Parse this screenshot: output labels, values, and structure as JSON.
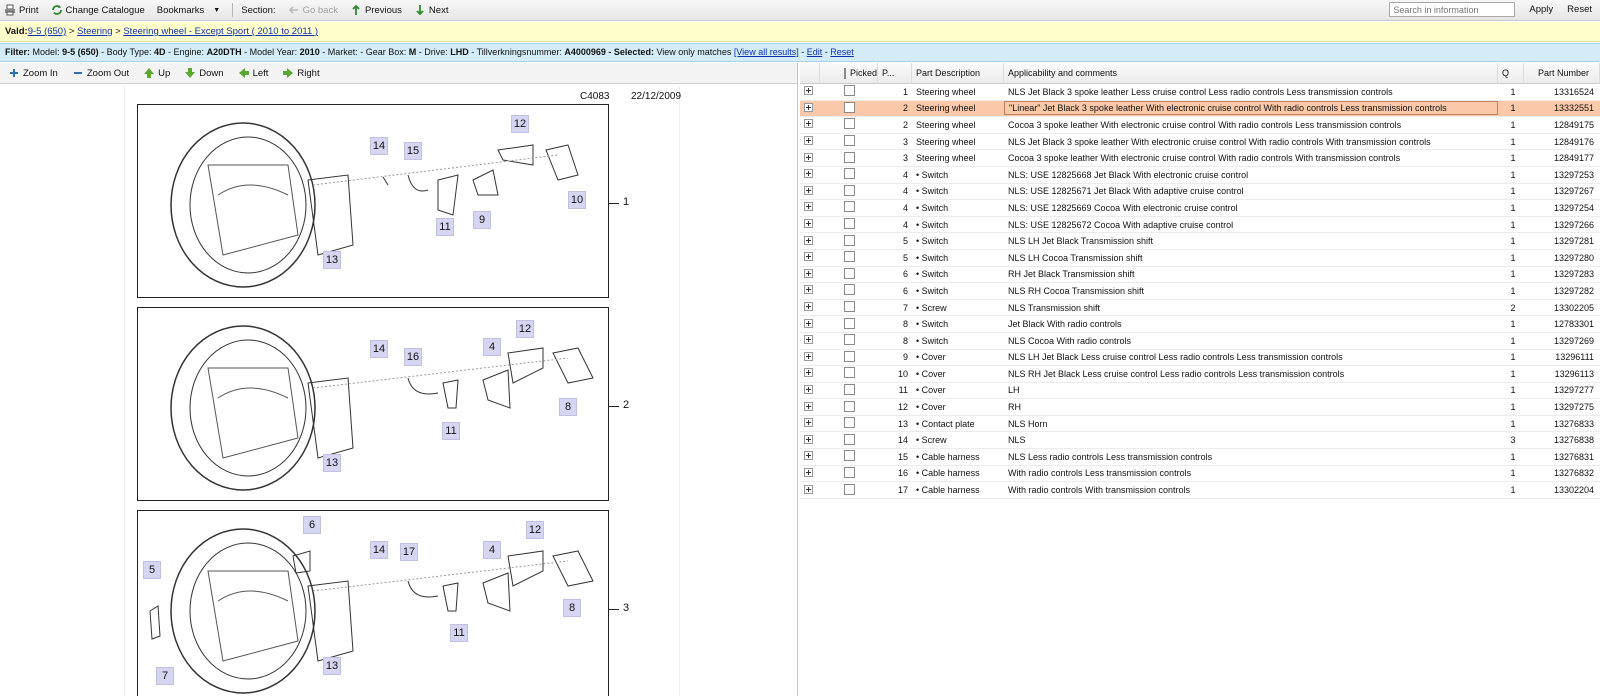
{
  "toolbar": {
    "print": "Print",
    "change_catalogue": "Change Catalogue",
    "bookmarks": "Bookmarks",
    "section": "Section:",
    "go_back": "Go back",
    "previous": "Previous",
    "next": "Next",
    "search_placeholder": "Search in information",
    "apply": "Apply",
    "reset": "Reset"
  },
  "breadcrumb": {
    "label": "Vald:",
    "items": [
      "9-5 (650)",
      "Steering",
      "Steering wheel - Except Sport ( 2010 to 2011 )"
    ],
    "sep": ">"
  },
  "filter": {
    "label": "Filter:",
    "t_model": "Model:",
    "v_model": "9-5 (650)",
    "t_body": "- Body Type:",
    "v_body": "4D",
    "t_engine": "- Engine:",
    "v_engine": "A20DTH",
    "t_year": "- Model Year:",
    "v_year": "2010",
    "t_market": "- Market: - Gear Box:",
    "v_gear": "M",
    "t_drive": "- Drive:",
    "v_drive": "LHD",
    "t_vin": "- Tillverkningsnummer:",
    "v_vin": "A4000969",
    "t_selected": "- Selected:",
    "v_selected": "View only matches",
    "view_all": "[View all results]",
    "dash1": "-",
    "edit": "Edit",
    "dash2": "-",
    "reset": "Reset"
  },
  "viewer": {
    "zoom_in": "Zoom In",
    "zoom_out": "Zoom Out",
    "up": "Up",
    "down": "Down",
    "left": "Left",
    "right": "Right",
    "sheet_id": "C4083",
    "sheet_date": "22/12/2009",
    "panels": [
      {
        "number": "1",
        "callouts": [
          "14",
          "15",
          "12",
          "10",
          "9",
          "11",
          "13"
        ]
      },
      {
        "number": "2",
        "callouts": [
          "14",
          "16",
          "4",
          "12",
          "8",
          "11",
          "13"
        ]
      },
      {
        "number": "3",
        "callouts": [
          "6",
          "5",
          "7",
          "14",
          "17",
          "4",
          "12",
          "8",
          "11",
          "13"
        ]
      }
    ]
  },
  "grid": {
    "headers": {
      "picked": "Picked",
      "p": "P...",
      "desc": "Part Description",
      "app": "Applicability and comments",
      "q": "Q",
      "pn": "Part Number"
    },
    "rows": [
      {
        "p": "1",
        "desc": "Steering wheel",
        "app": "NLS Jet Black 3 spoke leather Less cruise control Less radio controls Less transmission controls",
        "q": "1",
        "pn": "13316524"
      },
      {
        "p": "2",
        "desc": "Steering wheel",
        "app": "\"Linear\" Jet Black 3 spoke leather With electronic cruise control With radio controls Less transmission controls",
        "q": "1",
        "pn": "13332551"
      },
      {
        "p": "2",
        "desc": "Steering wheel",
        "app": "Cocoa 3 spoke leather With electronic cruise control With radio controls Less transmission controls",
        "q": "1",
        "pn": "12849175"
      },
      {
        "p": "3",
        "desc": "Steering wheel",
        "app": "NLS Jet Black 3 spoke leather With electronic cruise control With radio controls With transmission controls",
        "q": "1",
        "pn": "12849176"
      },
      {
        "p": "3",
        "desc": "Steering wheel",
        "app": "Cocoa 3 spoke leather With electronic cruise control With radio controls With transmission controls",
        "q": "1",
        "pn": "12849177"
      },
      {
        "p": "4",
        "desc": "• Switch",
        "app": "NLS: USE 12825668 Jet Black With electronic cruise control",
        "q": "1",
        "pn": "13297253"
      },
      {
        "p": "4",
        "desc": "• Switch",
        "app": "NLS: USE 12825671 Jet Black With adaptive cruise control",
        "q": "1",
        "pn": "13297267"
      },
      {
        "p": "4",
        "desc": "• Switch",
        "app": "NLS: USE 12825669 Cocoa With electronic cruise control",
        "q": "1",
        "pn": "13297254"
      },
      {
        "p": "4",
        "desc": "• Switch",
        "app": "NLS: USE 12825672 Cocoa With adaptive cruise control",
        "q": "1",
        "pn": "13297266"
      },
      {
        "p": "5",
        "desc": "• Switch",
        "app": "NLS LH Jet Black Transmission shift",
        "q": "1",
        "pn": "13297281"
      },
      {
        "p": "5",
        "desc": "• Switch",
        "app": "NLS LH Cocoa Transmission shift",
        "q": "1",
        "pn": "13297280"
      },
      {
        "p": "6",
        "desc": "• Switch",
        "app": "RH Jet Black Transmission shift",
        "q": "1",
        "pn": "13297283"
      },
      {
        "p": "6",
        "desc": "• Switch",
        "app": "NLS RH Cocoa Transmission shift",
        "q": "1",
        "pn": "13297282"
      },
      {
        "p": "7",
        "desc": "• Screw",
        "app": "NLS Transmission shift",
        "q": "2",
        "pn": "13302205"
      },
      {
        "p": "8",
        "desc": "• Switch",
        "app": "Jet Black With radio controls",
        "q": "1",
        "pn": "12783301"
      },
      {
        "p": "8",
        "desc": "• Switch",
        "app": "NLS Cocoa With radio controls",
        "q": "1",
        "pn": "13297269"
      },
      {
        "p": "9",
        "desc": "• Cover",
        "app": "NLS LH Jet Black Less cruise control Less radio controls Less transmission controls",
        "q": "1",
        "pn": "13296111"
      },
      {
        "p": "10",
        "desc": "• Cover",
        "app": "NLS RH Jet Black Less cruise control Less radio controls Less transmission controls",
        "q": "1",
        "pn": "13296113"
      },
      {
        "p": "11",
        "desc": "• Cover",
        "app": "LH",
        "q": "1",
        "pn": "13297277"
      },
      {
        "p": "12",
        "desc": "• Cover",
        "app": "RH",
        "q": "1",
        "pn": "13297275"
      },
      {
        "p": "13",
        "desc": "• Contact plate",
        "app": "NLS Horn",
        "q": "1",
        "pn": "13276833"
      },
      {
        "p": "14",
        "desc": "• Screw",
        "app": "NLS",
        "q": "3",
        "pn": "13276838"
      },
      {
        "p": "15",
        "desc": "• Cable harness",
        "app": "NLS Less radio controls Less transmission controls",
        "q": "1",
        "pn": "13276831"
      },
      {
        "p": "16",
        "desc": "• Cable harness",
        "app": "With radio controls Less transmission controls",
        "q": "1",
        "pn": "13276832"
      },
      {
        "p": "17",
        "desc": "• Cable harness",
        "app": "With radio controls With transmission controls",
        "q": "1",
        "pn": "13302204"
      }
    ],
    "selected_row": 1
  },
  "colors": {
    "selected_row": "#f9c9a9",
    "breadcrumb_bg": "#ffffcc",
    "filter_bg": "#d4ecf7",
    "callout_bg": "#d6d6f2"
  }
}
